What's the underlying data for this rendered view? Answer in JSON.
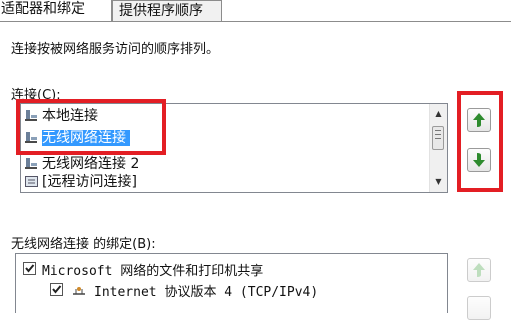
{
  "tabs": [
    {
      "label": "适配器和绑定",
      "active": true
    },
    {
      "label": "提供程序顺序",
      "active": false
    }
  ],
  "instruction": "连接按被网络服务访问的顺序排列。",
  "connections_label": "连接(C):",
  "connections": [
    {
      "label": "本地连接",
      "icon": "network-adapter-icon"
    },
    {
      "label": "无线网络连接",
      "icon": "network-adapter-icon",
      "selected": true
    },
    {
      "label": "无线网络连接 2",
      "icon": "network-adapter-icon"
    },
    {
      "label": "[远程访问连接]",
      "icon": "remote-access-icon"
    }
  ],
  "bindings_label": "无线网络连接 的绑定(B):",
  "bindings": [
    {
      "label": "Microsoft 网络的文件和打印机共享",
      "checked": true
    },
    {
      "label": "Internet 协议版本 4 (TCP/IPv4)",
      "checked": true
    }
  ],
  "colors": {
    "highlight": "#e31e24",
    "selection": "#3399ff",
    "arrow": "#2e8b2e"
  },
  "icons": {
    "up": "green-up-arrow-icon",
    "down": "green-down-arrow-icon"
  }
}
